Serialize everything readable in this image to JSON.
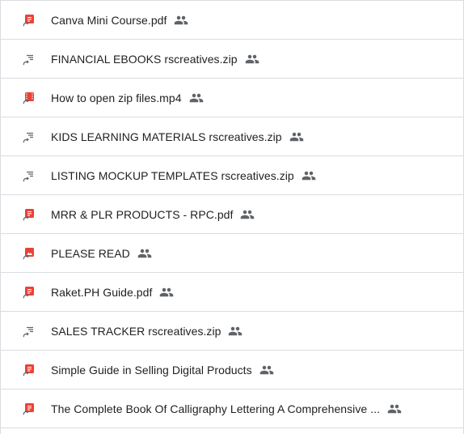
{
  "colors": {
    "pdf_red": "#ea4335",
    "zip_gray": "#5f6368",
    "text": "#1f1f1f",
    "divider": "#dadce0"
  },
  "files": [
    {
      "name": "Canva Mini Course.pdf",
      "type": "pdf-icon",
      "shared": true
    },
    {
      "name": "FINANCIAL EBOOKS rscreatives.zip",
      "type": "zip-shortcut-icon",
      "shared": true
    },
    {
      "name": "How to open zip files.mp4",
      "type": "video-icon",
      "shared": true
    },
    {
      "name": "KIDS LEARNING MATERIALS rscreatives.zip",
      "type": "zip-shortcut-icon",
      "shared": true
    },
    {
      "name": "LISTING MOCKUP TEMPLATES rscreatives.zip",
      "type": "zip-shortcut-icon",
      "shared": true
    },
    {
      "name": "MRR & PLR PRODUCTS - RPC.pdf",
      "type": "pdf-icon",
      "shared": true
    },
    {
      "name": "PLEASE READ",
      "type": "image-icon",
      "shared": true
    },
    {
      "name": "Raket.PH Guide.pdf",
      "type": "pdf-icon",
      "shared": true
    },
    {
      "name": "SALES TRACKER rscreatives.zip",
      "type": "zip-shortcut-icon",
      "shared": true
    },
    {
      "name": "Simple Guide in Selling Digital Products",
      "type": "pdf-icon",
      "shared": true
    },
    {
      "name": "The Complete Book Of Calligraphy Lettering A Comprehensive ...",
      "type": "pdf-icon",
      "shared": true
    }
  ]
}
